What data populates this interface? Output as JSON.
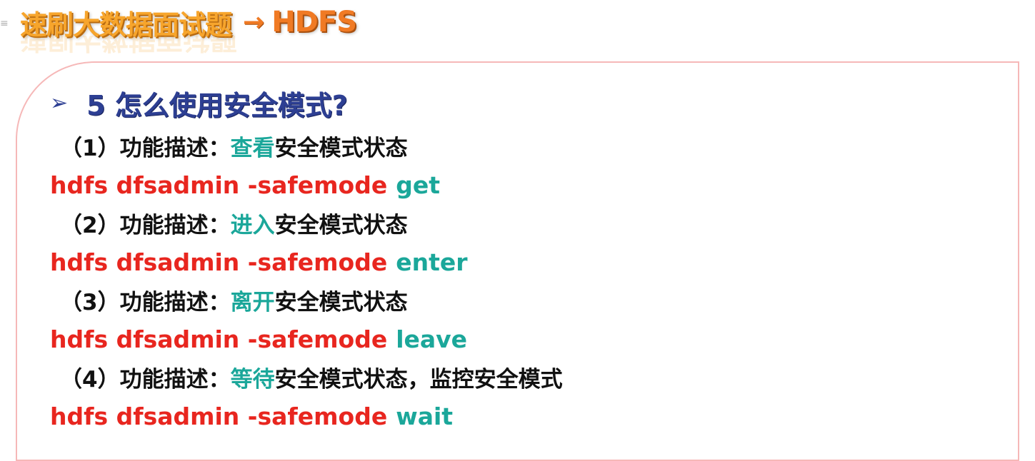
{
  "banner": {
    "menu_glyph": "≡",
    "title": "速刷大数据面试题",
    "arrow": "→",
    "topic": "HDFS"
  },
  "section": {
    "bullet_icon": "➢",
    "heading": "5 怎么使用安全模式?"
  },
  "items": [
    {
      "prefix": "（1）功能描述：",
      "highlight": "查看",
      "suffix": "安全模式状态",
      "command": "hdfs dfsadmin -safemode",
      "arg": "get"
    },
    {
      "prefix": "（2）功能描述：",
      "highlight": "进入",
      "suffix": "安全模式状态",
      "command": "hdfs dfsadmin -safemode",
      "arg": "enter"
    },
    {
      "prefix": "（3）功能描述：",
      "highlight": "离开",
      "suffix": "安全模式状态",
      "command": "hdfs dfsadmin -safemode",
      "arg": "leave"
    },
    {
      "prefix": "（4）功能描述：",
      "highlight": "等待",
      "suffix": "安全模式状态，监控安全模式",
      "command": "hdfs dfsadmin -safemode",
      "arg": "wait"
    }
  ],
  "colors": {
    "banner_title": "#f7a52c",
    "banner_topic": "#f07a24",
    "heading": "#2d3f93",
    "command": "#e8261f",
    "highlight": "#1ba79a",
    "frame_border": "#f6b8b8"
  }
}
